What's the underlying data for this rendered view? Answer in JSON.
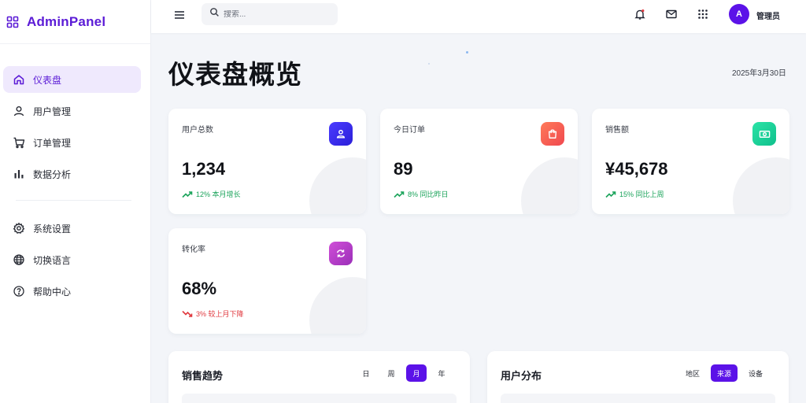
{
  "brand": {
    "name": "AdminPanel"
  },
  "sidebar": {
    "items": [
      {
        "label": "仪表盘",
        "icon": "home-icon",
        "active": true
      },
      {
        "label": "用户管理",
        "icon": "user-icon"
      },
      {
        "label": "订单管理",
        "icon": "cart-icon"
      },
      {
        "label": "数据分析",
        "icon": "bar-chart-icon"
      }
    ],
    "secondary": [
      {
        "label": "系统设置",
        "icon": "gear-icon"
      },
      {
        "label": "切换语言",
        "icon": "globe-icon"
      },
      {
        "label": "帮助中心",
        "icon": "help-icon"
      }
    ]
  },
  "topbar": {
    "search_placeholder": "搜索...",
    "user_initial": "A",
    "user_name": "管理员"
  },
  "main": {
    "title": "仪表盘概览",
    "date": "2025年3月30日"
  },
  "stats": [
    {
      "label": "用户总数",
      "value": "1,234",
      "trend": "12% 本月增长",
      "direction": "up",
      "icon": "user-badge-icon",
      "color": "#3d2ff0"
    },
    {
      "label": "今日订单",
      "value": "89",
      "trend": "8% 同比昨日",
      "direction": "up",
      "icon": "shopping-bag-icon",
      "color": "#f5605a"
    },
    {
      "label": "销售额",
      "value": "¥45,678",
      "trend": "15% 同比上周",
      "direction": "up",
      "icon": "cash-icon",
      "color": "#1fd3a0"
    },
    {
      "label": "转化率",
      "value": "68%",
      "trend": "3% 较上月下降",
      "direction": "down",
      "icon": "refresh-icon",
      "color": "#c13cc9"
    }
  ],
  "panels": [
    {
      "title": "销售趋势",
      "tabs": [
        "日",
        "周",
        "月",
        "年"
      ],
      "active_tab": "月"
    },
    {
      "title": "用户分布",
      "tabs": [
        "地区",
        "来源",
        "设备"
      ],
      "active_tab": "来源"
    }
  ],
  "colors": {
    "accent": "#5b12e8",
    "up": "#1aa35a",
    "down": "#e0383e"
  }
}
